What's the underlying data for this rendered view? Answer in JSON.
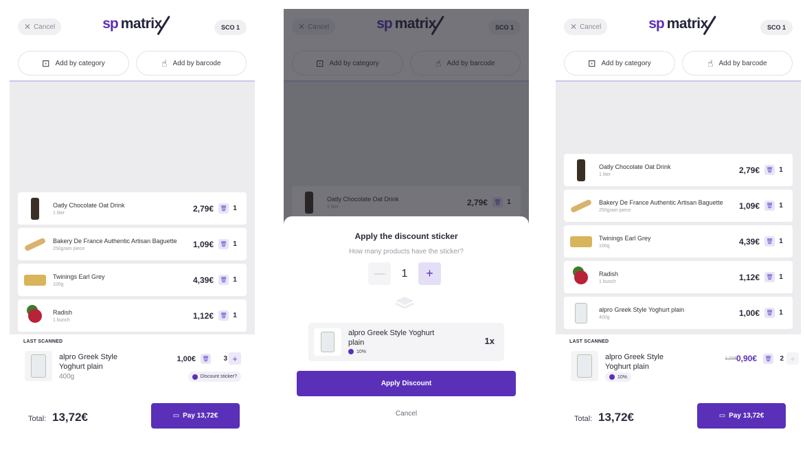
{
  "header": {
    "cancel_label": "Cancel",
    "logo_sp": "sp",
    "logo_matrix": "matrix",
    "station": "SCO 1"
  },
  "add": {
    "category_label": "Add by category",
    "barcode_label": "Add by barcode"
  },
  "cart_items": [
    {
      "name": "Oatly Chocolate Oat Drink",
      "sub": "1 liter",
      "price": "2,79€",
      "qty": "1"
    },
    {
      "name": "Bakery De France Authentic Artisan Baguette",
      "sub": "250gram piece",
      "price": "1,09€",
      "qty": "1"
    },
    {
      "name": "Twinings Earl Grey",
      "sub": "100g",
      "price": "4,39€",
      "qty": "1"
    },
    {
      "name": "Radish",
      "sub": "1 bunch",
      "price": "1,12€",
      "qty": "1"
    },
    {
      "name": "alpro Greek Style Yoghurt plain",
      "sub": "400g",
      "price": "1,00€",
      "qty": "1"
    }
  ],
  "last_scanned": {
    "title": "LAST SCANNED",
    "name": "alpro Greek Style Yoghurt plain",
    "weight": "400g",
    "price": "1,00€",
    "qty": "3",
    "sticker_link": "Discount sticker?"
  },
  "last_scanned_after": {
    "old_price": "1,00€",
    "new_price": "0,90€",
    "qty": "2",
    "percent": "10%"
  },
  "footer": {
    "total_label": "Total:",
    "total_value": "13,72€",
    "pay_label": "Pay 13,72€"
  },
  "modal": {
    "title": "Apply the discount sticker",
    "subtitle": "How many products have the sticker?",
    "stepper_minus": "—",
    "stepper_value": "1",
    "stepper_plus": "+",
    "product_name": "alpro Greek Style Yoghurt plain",
    "product_percent": "10%",
    "product_count": "1x",
    "apply_label": "Apply Discount",
    "cancel_label": "Cancel"
  },
  "colors": {
    "brand": "#5a30b8",
    "cart_bg": "#ececee"
  }
}
